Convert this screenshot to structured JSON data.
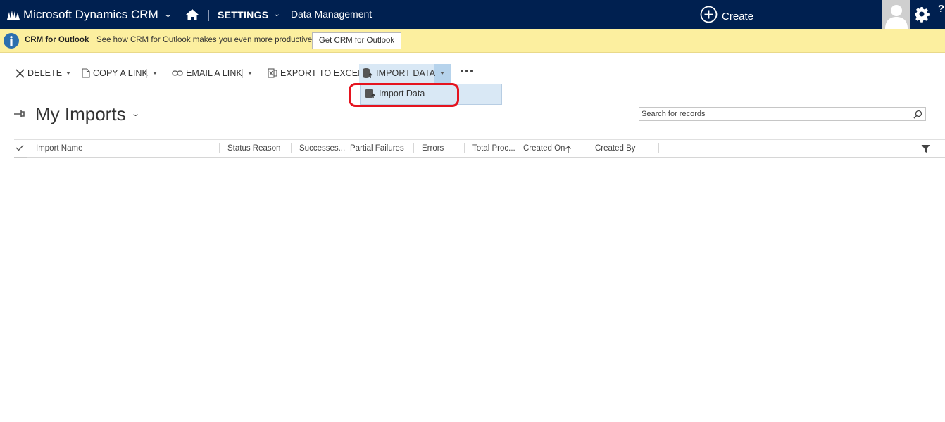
{
  "nav": {
    "brand": "Microsoft Dynamics CRM",
    "settings": "SETTINGS",
    "area": "Data Management",
    "create": "Create"
  },
  "notification": {
    "title": "CRM for Outlook",
    "message": "See how CRM for Outlook makes you even more productive.",
    "button": "Get CRM for Outlook"
  },
  "commands": {
    "delete": "DELETE",
    "copy_link": "COPY A LINK",
    "email_link": "EMAIL A LINK",
    "export_excel": "EXPORT TO EXCEL",
    "import_data": "IMPORT DATA"
  },
  "dropdown": {
    "item": "Import Data"
  },
  "view": {
    "title": "My Imports"
  },
  "search": {
    "placeholder": "Search for records"
  },
  "grid": {
    "columns": [
      "Import Name",
      "Status Reason",
      "Successes...",
      "Partial Failures",
      "Errors",
      "Total Proc...",
      "Created On",
      "Created By"
    ],
    "rows": []
  },
  "colors": {
    "nav_bg": "#002050",
    "notify_bg": "#fcef9f",
    "highlight": "#d9e8f5",
    "callout": "#e5141f"
  }
}
